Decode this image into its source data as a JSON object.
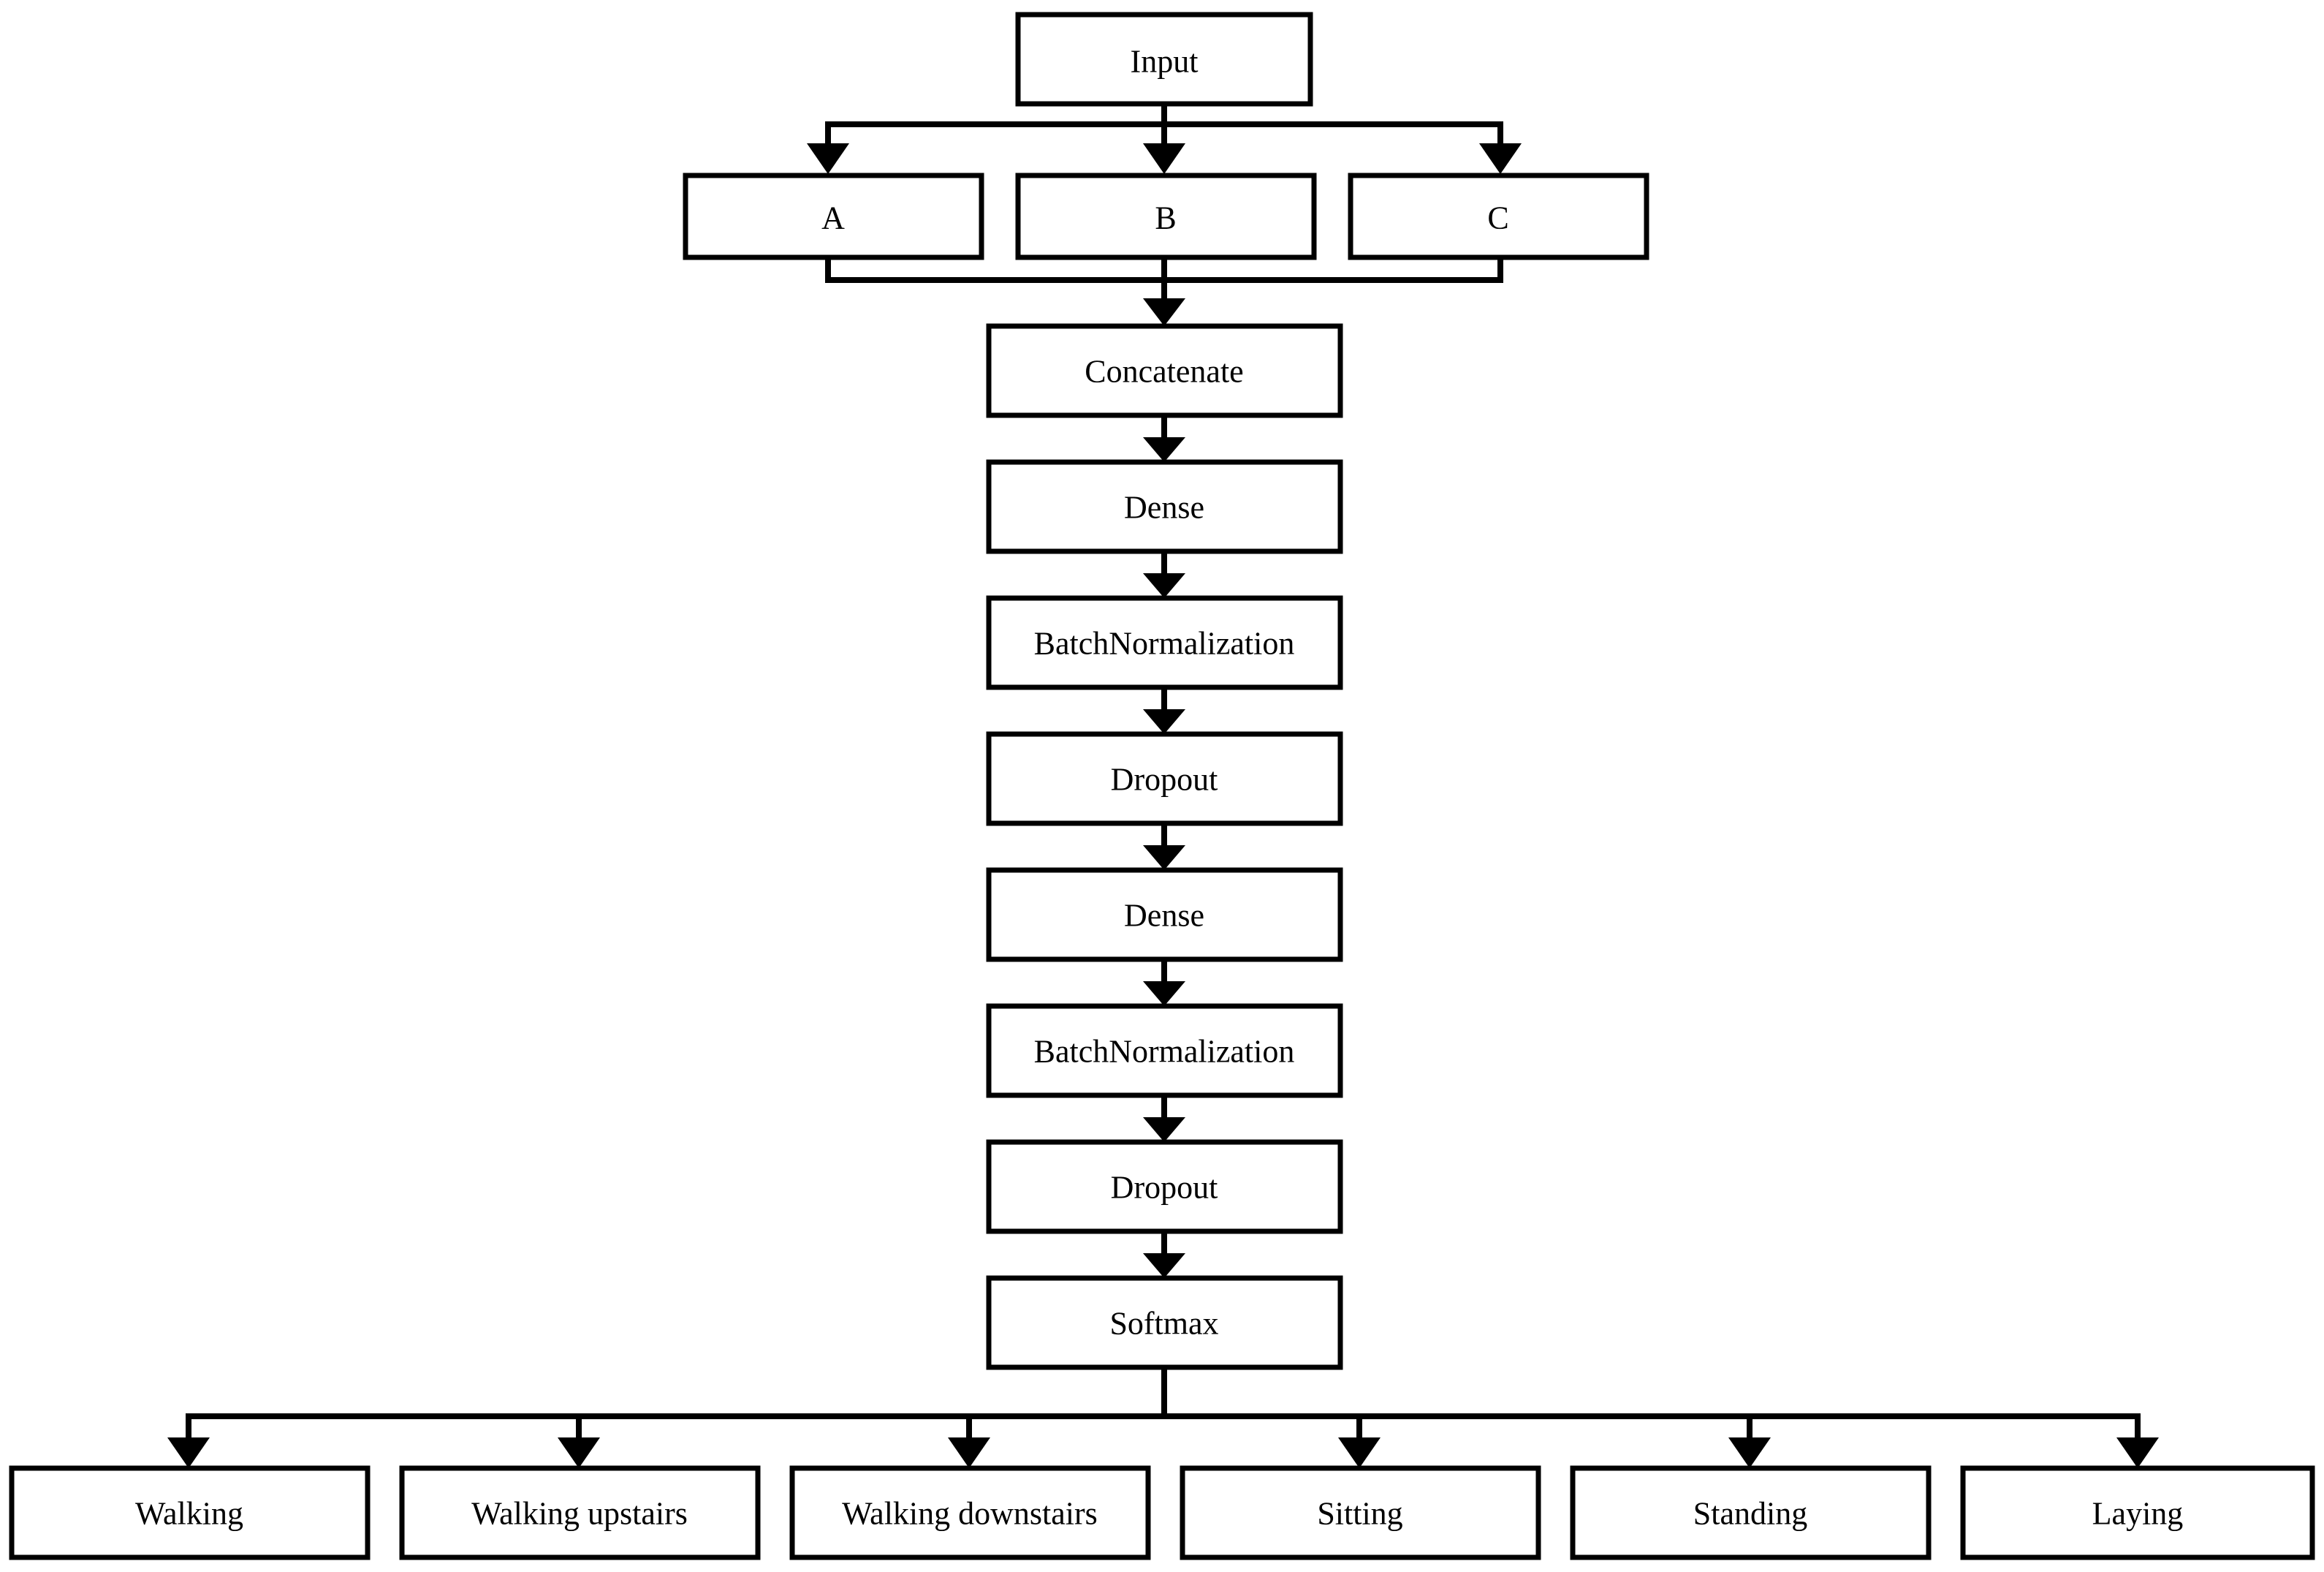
{
  "diagram": {
    "title": "Neural network architecture flowchart",
    "type": "flowchart",
    "orientation": "top-to-bottom",
    "background_color": "#ffffff",
    "line_color": "#000000",
    "box_fill_color": "#ffffff",
    "font_size_px": 44
  },
  "nodes": {
    "input": {
      "label": "Input"
    },
    "branches": [
      {
        "id": "a",
        "label": "A"
      },
      {
        "id": "b",
        "label": "B"
      },
      {
        "id": "c",
        "label": "C"
      }
    ],
    "trunk": [
      {
        "id": "concatenate",
        "label": "Concatenate"
      },
      {
        "id": "dense_1",
        "label": "Dense"
      },
      {
        "id": "batchnorm_1",
        "label": "BatchNormalization"
      },
      {
        "id": "dropout_1",
        "label": "Dropout"
      },
      {
        "id": "dense_2",
        "label": "Dense"
      },
      {
        "id": "batchnorm_2",
        "label": "BatchNormalization"
      },
      {
        "id": "dropout_2",
        "label": "Dropout"
      },
      {
        "id": "softmax",
        "label": "Softmax"
      }
    ],
    "outputs": [
      {
        "id": "walking",
        "label": "Walking"
      },
      {
        "id": "walking_upstairs",
        "label": "Walking upstairs"
      },
      {
        "id": "walking_downstairs",
        "label": "Walking downstairs"
      },
      {
        "id": "sitting",
        "label": "Sitting"
      },
      {
        "id": "standing",
        "label": "Standing"
      },
      {
        "id": "laying",
        "label": "Laying"
      }
    ]
  }
}
